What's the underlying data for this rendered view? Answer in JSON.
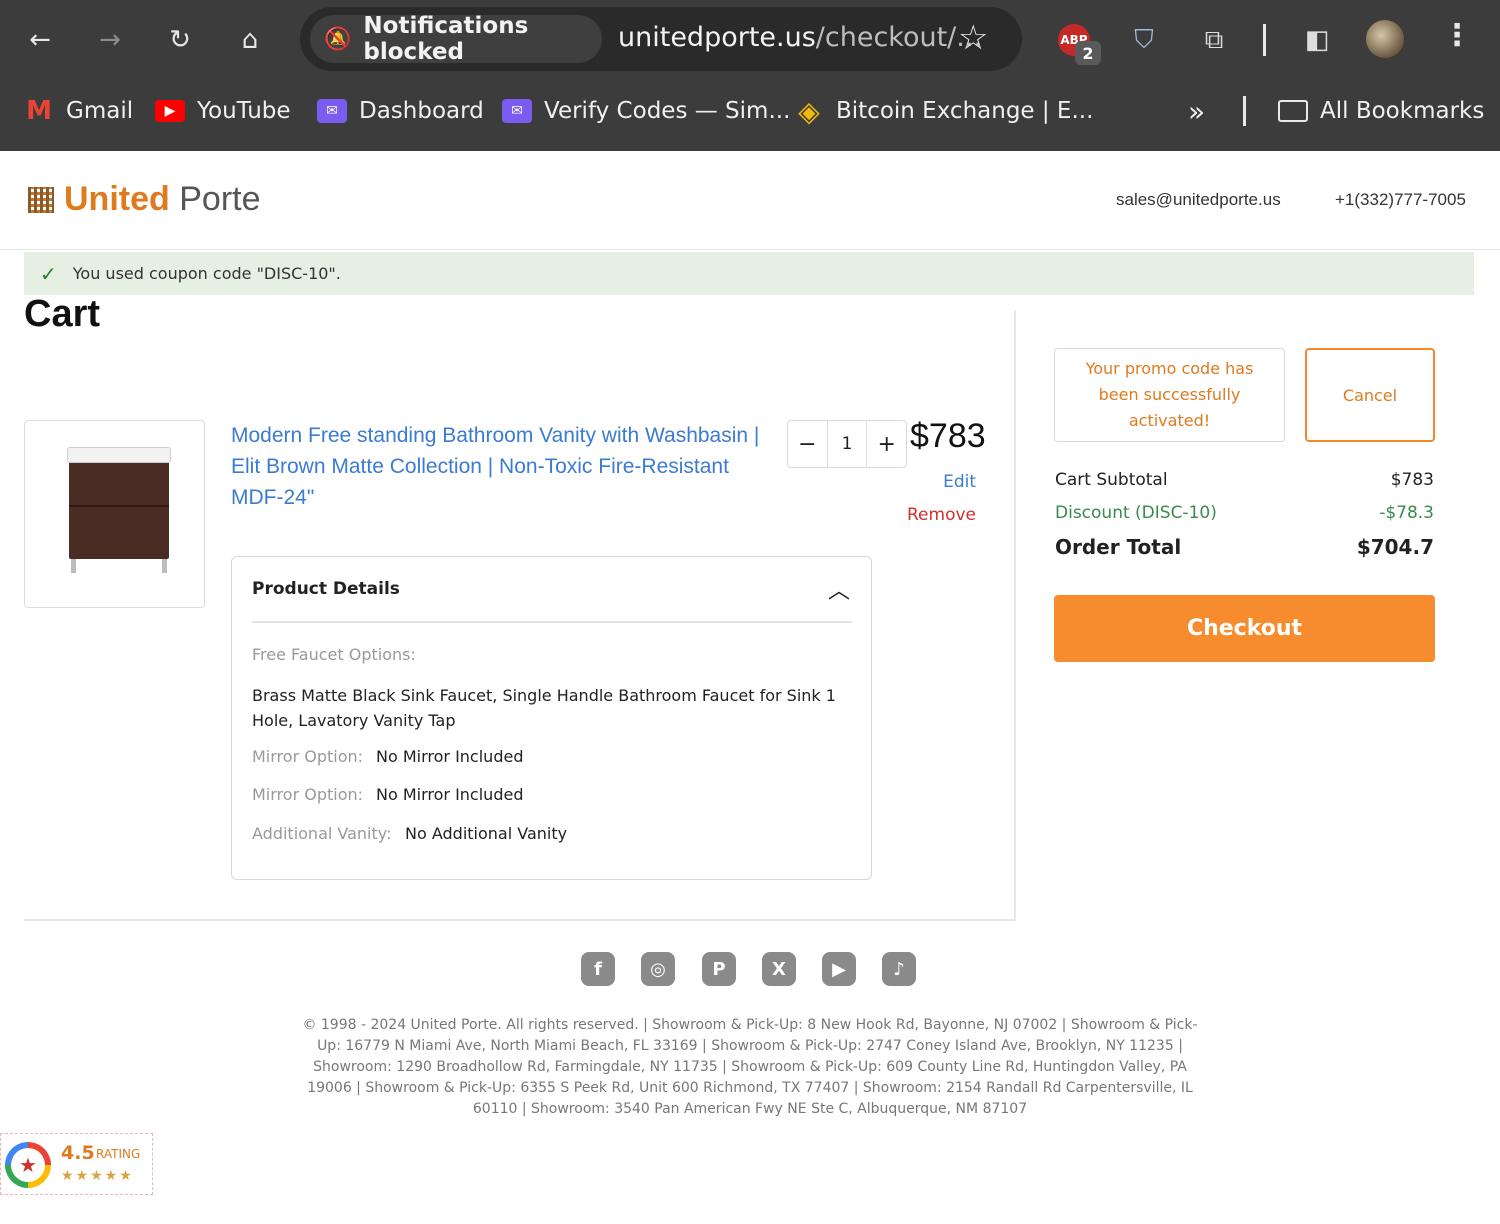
{
  "browser": {
    "notification_chip": "Notifications blocked",
    "url_host": "unitedporte.us",
    "url_path": "/checkout/...",
    "extension_badge": "2",
    "bookmarks": [
      {
        "label": "Gmail",
        "icon": "gmail-icon"
      },
      {
        "label": "YouTube",
        "icon": "youtube-icon"
      },
      {
        "label": "Dashboard",
        "icon": "proton-icon"
      },
      {
        "label": "Verify Codes — Sim...",
        "icon": "proton-icon"
      },
      {
        "label": "Bitcoin Exchange | E...",
        "icon": "binance-icon"
      }
    ],
    "all_bookmarks": "All Bookmarks",
    "overflow": "»"
  },
  "header": {
    "logo_bold": "United",
    "logo_rest": "Porte",
    "email": "sales@unitedporte.us",
    "phone": "+1(332)777-7005"
  },
  "notice": {
    "coupon_text": "You used coupon code \"DISC-10\"."
  },
  "cart": {
    "title": "Cart",
    "item": {
      "title": "Modern Free standing Bathroom Vanity with Washbasin | Elit Brown Matte Collection | Non-Toxic Fire-Resistant MDF-24\"",
      "quantity": "1",
      "price": "$783",
      "edit_label": "Edit",
      "remove_label": "Remove",
      "details_heading": "Product Details",
      "details": {
        "faucet_label": "Free Faucet Options:",
        "faucet_value": "Brass Matte Black Sink Faucet, Single Handle Bathroom Faucet for Sink 1 Hole, Lavatory Vanity Tap",
        "mirror_label_1": "Mirror Option:",
        "mirror_value_1": "No Mirror Included",
        "mirror_label_2": "Mirror Option:",
        "mirror_value_2": "No Mirror Included",
        "vanity_label": "Additional Vanity:",
        "vanity_value": "No Additional Vanity"
      }
    }
  },
  "summary": {
    "promo_message": "Your promo code has been successfully activated!",
    "cancel_label": "Cancel",
    "subtotal_label": "Cart Subtotal",
    "subtotal_value": "$783",
    "discount_label": "Discount (DISC-10)",
    "discount_value": "-$78.3",
    "total_label": "Order Total",
    "total_value": "$704.7",
    "checkout_label": "Checkout"
  },
  "footer": {
    "social_icons": [
      "facebook-icon",
      "instagram-icon",
      "pinterest-icon",
      "x-icon",
      "youtube-icon",
      "tiktok-icon"
    ],
    "address": "© 1998 - 2024 United Porte. All rights reserved. | Showroom & Pick-Up: 8 New Hook Rd, Bayonne, NJ 07002 | Showroom & Pick-Up: 16779 N Miami Ave, North Miami Beach, FL 33169 | Showroom & Pick-Up: 2747 Coney Island Ave, Brooklyn, NY 11235 | Showroom: 1290 Broadhollow Rd, Farmingdale, NY 11735 | Showroom & Pick-Up: 609 County Line Rd, Huntingdon Valley, PA 19006 | Showroom & Pick-Up: 6355 S Peek Rd, Unit 600 Richmond, TX 77407 | Showroom: 2154 Randall Rd Carpentersville, IL 60110 | Showroom: 3540 Pan American Fwy NE Ste C, Albuquerque, NM 87107"
  },
  "rating": {
    "score": "4.5",
    "word": "RATING",
    "stars": "★★★★★"
  },
  "colors": {
    "brand_orange": "#f68c2e",
    "link_blue": "#3b7bd1",
    "remove_red": "#d32f2f",
    "success_bg": "#e6f0e2",
    "discount_green": "#3a8a4a"
  }
}
